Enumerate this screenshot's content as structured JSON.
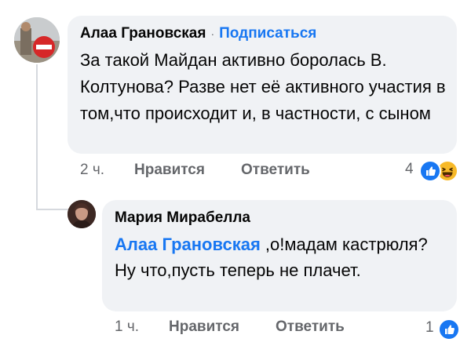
{
  "comment": {
    "author": "Алаа Грановская",
    "separator": "·",
    "follow_label": "Подписаться",
    "text": "За такой Майдан активно боролась В. Колтунова? Разве нет её активного участия в том,что происходит и, в частности, с сыном",
    "time": "2 ч.",
    "like_label": "Нравится",
    "reply_label": "Ответить",
    "reaction_count": "4",
    "reactions": [
      "like-icon",
      "haha-icon"
    ]
  },
  "reply": {
    "author": "Мария Мирабелла",
    "mention": "Алаа Грановская",
    "text": ",о!мадам кастрюля?\nНу что,пусть теперь не плачет.",
    "time": "1 ч.",
    "like_label": "Нравится",
    "reply_label": "Ответить",
    "reaction_count": "1",
    "reactions": [
      "like-icon"
    ]
  },
  "colors": {
    "bubble": "#f0f2f5",
    "link": "#1877f2",
    "meta": "#65676b",
    "text": "#050505"
  }
}
